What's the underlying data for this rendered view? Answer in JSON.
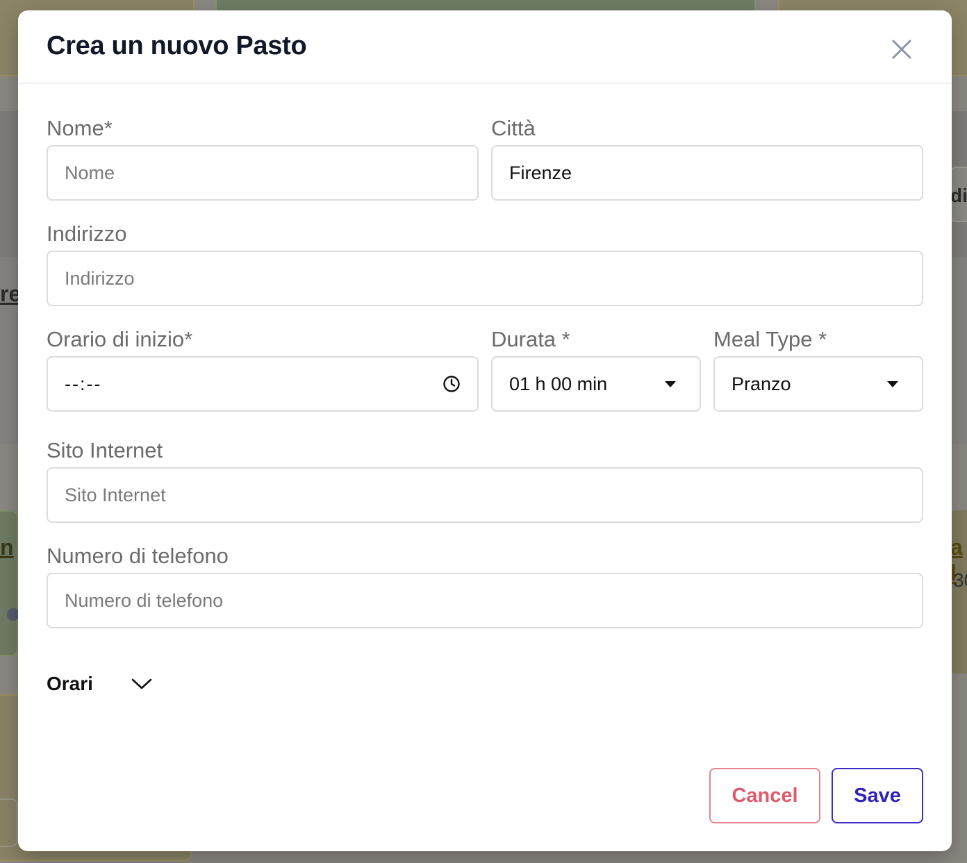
{
  "modal": {
    "title": "Crea un nuovo Pasto"
  },
  "fields": {
    "nome": {
      "label": "Nome*",
      "placeholder": "Nome",
      "value": ""
    },
    "citta": {
      "label": "Città",
      "value": "Firenze"
    },
    "indirizzo": {
      "label": "Indirizzo",
      "placeholder": "Indirizzo",
      "value": ""
    },
    "orario": {
      "label": "Orario di inizio*",
      "value": "--:--"
    },
    "durata": {
      "label": "Durata *",
      "value": "01 h 00 min"
    },
    "meal_type": {
      "label": "Meal Type *",
      "value": "Pranzo"
    },
    "sito": {
      "label": "Sito Internet",
      "placeholder": "Sito Internet",
      "value": ""
    },
    "telefono": {
      "label": "Numero di telefono",
      "placeholder": "Numero di telefono",
      "value": ""
    }
  },
  "orari": {
    "label": "Orari"
  },
  "buttons": {
    "cancel": "Cancel",
    "save": "Save"
  },
  "colors": {
    "cancel": "#e05a6d",
    "save": "#2f22b8",
    "title": "#111827"
  },
  "background": {
    "text_1": "re",
    "text_2": "di",
    "text_3": "n",
    "text_4": "a l",
    "text_5": "30"
  }
}
